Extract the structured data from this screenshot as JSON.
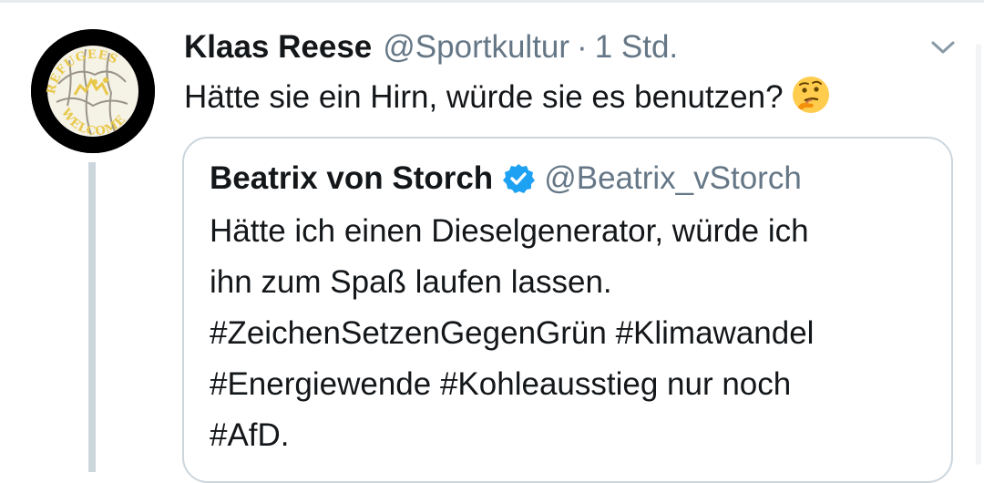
{
  "tweet": {
    "author_name": "Klaas Reese",
    "author_handle": "@Sportkultur",
    "separator": "·",
    "timestamp": "1 Std.",
    "text": "Hätte sie ein Hirn, würde sie es benutzen?",
    "emoji": "thinking-face-icon",
    "avatar": {
      "badge_text_top": "REFUGEES",
      "badge_text_bottom": "WELCOME",
      "colors": {
        "ring": "#000000",
        "ball": "#f5f2e6",
        "text": "#e8c84a"
      }
    },
    "menu_icon": "chevron-down-icon"
  },
  "quoted_tweet": {
    "author_name": "Beatrix von Storch",
    "verified_icon": "verified-badge-icon",
    "author_handle": "@Beatrix_vStorch",
    "lines": [
      "Hätte ich einen Dieselgenerator, würde ich",
      "ihn zum Spaß laufen lassen.",
      "#ZeichenSetzenGegenGrün #Klimawandel",
      "#Energiewende #Kohleausstieg nur noch",
      "#AfD."
    ]
  },
  "colors": {
    "text_primary": "#14171a",
    "text_secondary": "#657786",
    "border": "#ccd6dd",
    "verified_blue": "#1da1f2"
  }
}
